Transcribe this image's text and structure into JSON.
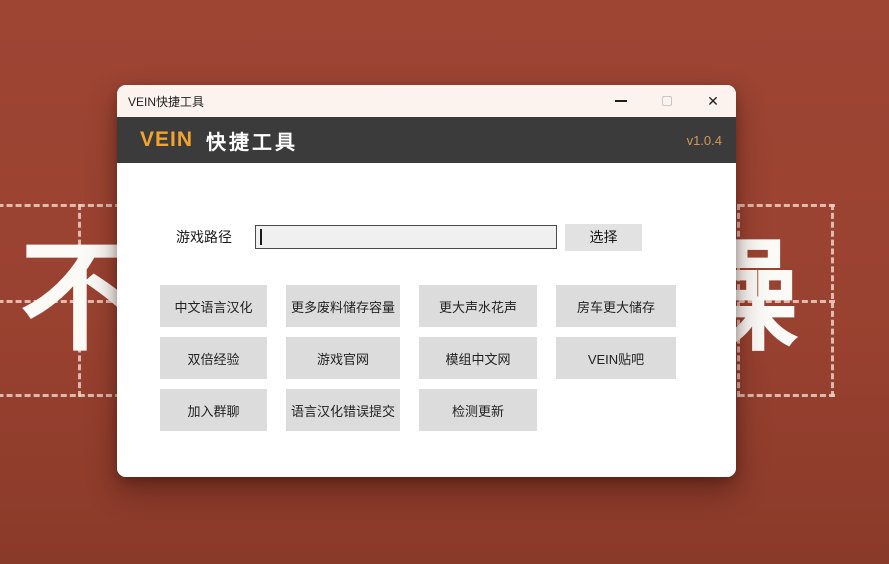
{
  "background": {
    "char_left": "不",
    "char_right": "躁"
  },
  "app": {
    "titlebar": {
      "title": "VEIN快捷工具",
      "minimize": "–",
      "maximize": "□",
      "close": "✕"
    },
    "header": {
      "brand": "VEIN",
      "title": "快捷工具",
      "version": "v1.0.4"
    },
    "path_row": {
      "label": "游戏路径",
      "input_value": "",
      "select_button": "选择"
    },
    "buttons": [
      [
        "中文语言汉化",
        "更多废料储存容量",
        "更大声水花声",
        "房车更大储存"
      ],
      [
        "双倍经验",
        "游戏官网",
        "模组中文网",
        "VEIN贴吧"
      ],
      [
        "加入群聊",
        "语言汉化错误提交",
        "检测更新"
      ]
    ]
  },
  "colors": {
    "wallpaper_bg": "#9a4231",
    "wallpaper_dash": "#f0cec4",
    "wallpaper_glyph": "#fbfaf7",
    "titlebar_bg": "#fcf2ee",
    "header_bg": "#3b3b3b",
    "accent_orange": "#f3a42c",
    "version_gold": "#cf9a55",
    "body_bg": "#ffffff",
    "button_bg": "#dcdcdc",
    "input_bg": "#f0f0f0",
    "input_border": "#4a4a4a"
  }
}
